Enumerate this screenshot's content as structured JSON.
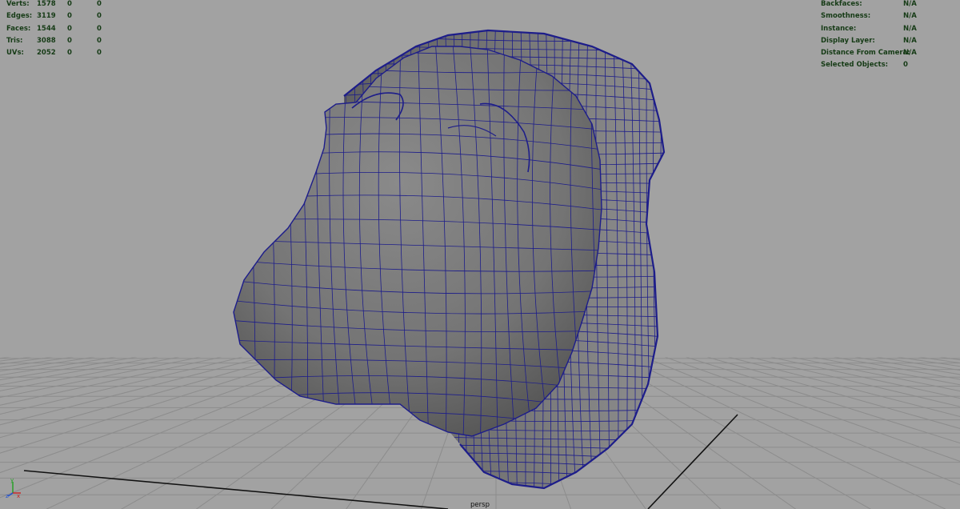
{
  "hud_left": {
    "rows": [
      {
        "label": "Verts:",
        "v1": "1578",
        "v2": "0",
        "v3": "0"
      },
      {
        "label": "Edges:",
        "v1": "3119",
        "v2": "0",
        "v3": "0"
      },
      {
        "label": "Faces:",
        "v1": "1544",
        "v2": "0",
        "v3": "0"
      },
      {
        "label": "Tris:",
        "v1": "3088",
        "v2": "0",
        "v3": "0"
      },
      {
        "label": "UVs:",
        "v1": "2052",
        "v2": "0",
        "v3": "0"
      }
    ]
  },
  "hud_right": {
    "rows": [
      {
        "label": "Backfaces:",
        "value": "N/A"
      },
      {
        "label": "Smoothness:",
        "value": "N/A"
      },
      {
        "label": "Instance:",
        "value": "N/A"
      },
      {
        "label": "Display Layer:",
        "value": "N/A"
      },
      {
        "label": "Distance From Camera:",
        "value": "N/A"
      },
      {
        "label": "Selected Objects:",
        "value": "0"
      }
    ]
  },
  "camera": {
    "label": "persp"
  },
  "axis_gizmo": {
    "y": "y",
    "z": "z",
    "x": "x"
  },
  "colors": {
    "viewport_bg": "#a2a2a2",
    "grid": "#8c8c8c",
    "grid_axis": "#111111",
    "wireframe": "#1d1d8a",
    "mesh_fill": "#7d7d7d",
    "hud_text": "#163b16",
    "axis_x": "#cc2020",
    "axis_y": "#20a020",
    "axis_z": "#2050d0"
  }
}
